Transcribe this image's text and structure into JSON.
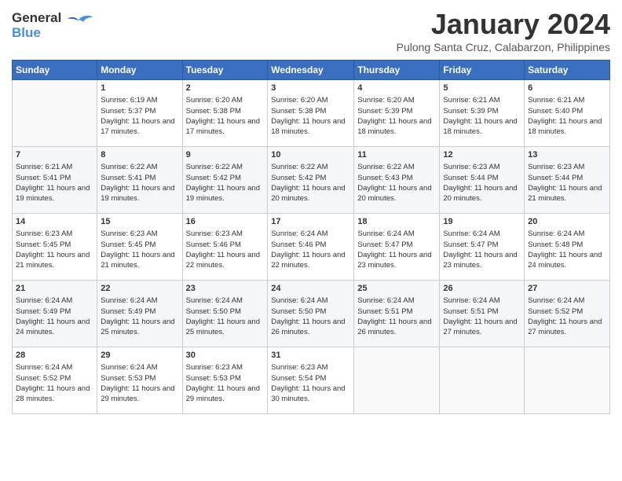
{
  "header": {
    "logo": {
      "line1": "General",
      "line2": "Blue"
    },
    "title": "January 2024",
    "location": "Pulong Santa Cruz, Calabarzon, Philippines"
  },
  "days_of_week": [
    "Sunday",
    "Monday",
    "Tuesday",
    "Wednesday",
    "Thursday",
    "Friday",
    "Saturday"
  ],
  "weeks": [
    [
      {
        "day": null
      },
      {
        "day": "1",
        "sunrise": "6:19 AM",
        "sunset": "5:37 PM",
        "daylight": "11 hours and 17 minutes."
      },
      {
        "day": "2",
        "sunrise": "6:20 AM",
        "sunset": "5:38 PM",
        "daylight": "11 hours and 17 minutes."
      },
      {
        "day": "3",
        "sunrise": "6:20 AM",
        "sunset": "5:38 PM",
        "daylight": "11 hours and 18 minutes."
      },
      {
        "day": "4",
        "sunrise": "6:20 AM",
        "sunset": "5:39 PM",
        "daylight": "11 hours and 18 minutes."
      },
      {
        "day": "5",
        "sunrise": "6:21 AM",
        "sunset": "5:39 PM",
        "daylight": "11 hours and 18 minutes."
      },
      {
        "day": "6",
        "sunrise": "6:21 AM",
        "sunset": "5:40 PM",
        "daylight": "11 hours and 18 minutes."
      }
    ],
    [
      {
        "day": "7",
        "sunrise": "6:21 AM",
        "sunset": "5:41 PM",
        "daylight": "11 hours and 19 minutes."
      },
      {
        "day": "8",
        "sunrise": "6:22 AM",
        "sunset": "5:41 PM",
        "daylight": "11 hours and 19 minutes."
      },
      {
        "day": "9",
        "sunrise": "6:22 AM",
        "sunset": "5:42 PM",
        "daylight": "11 hours and 19 minutes."
      },
      {
        "day": "10",
        "sunrise": "6:22 AM",
        "sunset": "5:42 PM",
        "daylight": "11 hours and 20 minutes."
      },
      {
        "day": "11",
        "sunrise": "6:22 AM",
        "sunset": "5:43 PM",
        "daylight": "11 hours and 20 minutes."
      },
      {
        "day": "12",
        "sunrise": "6:23 AM",
        "sunset": "5:44 PM",
        "daylight": "11 hours and 20 minutes."
      },
      {
        "day": "13",
        "sunrise": "6:23 AM",
        "sunset": "5:44 PM",
        "daylight": "11 hours and 21 minutes."
      }
    ],
    [
      {
        "day": "14",
        "sunrise": "6:23 AM",
        "sunset": "5:45 PM",
        "daylight": "11 hours and 21 minutes."
      },
      {
        "day": "15",
        "sunrise": "6:23 AM",
        "sunset": "5:45 PM",
        "daylight": "11 hours and 21 minutes."
      },
      {
        "day": "16",
        "sunrise": "6:23 AM",
        "sunset": "5:46 PM",
        "daylight": "11 hours and 22 minutes."
      },
      {
        "day": "17",
        "sunrise": "6:24 AM",
        "sunset": "5:46 PM",
        "daylight": "11 hours and 22 minutes."
      },
      {
        "day": "18",
        "sunrise": "6:24 AM",
        "sunset": "5:47 PM",
        "daylight": "11 hours and 23 minutes."
      },
      {
        "day": "19",
        "sunrise": "6:24 AM",
        "sunset": "5:47 PM",
        "daylight": "11 hours and 23 minutes."
      },
      {
        "day": "20",
        "sunrise": "6:24 AM",
        "sunset": "5:48 PM",
        "daylight": "11 hours and 24 minutes."
      }
    ],
    [
      {
        "day": "21",
        "sunrise": "6:24 AM",
        "sunset": "5:49 PM",
        "daylight": "11 hours and 24 minutes."
      },
      {
        "day": "22",
        "sunrise": "6:24 AM",
        "sunset": "5:49 PM",
        "daylight": "11 hours and 25 minutes."
      },
      {
        "day": "23",
        "sunrise": "6:24 AM",
        "sunset": "5:50 PM",
        "daylight": "11 hours and 25 minutes."
      },
      {
        "day": "24",
        "sunrise": "6:24 AM",
        "sunset": "5:50 PM",
        "daylight": "11 hours and 26 minutes."
      },
      {
        "day": "25",
        "sunrise": "6:24 AM",
        "sunset": "5:51 PM",
        "daylight": "11 hours and 26 minutes."
      },
      {
        "day": "26",
        "sunrise": "6:24 AM",
        "sunset": "5:51 PM",
        "daylight": "11 hours and 27 minutes."
      },
      {
        "day": "27",
        "sunrise": "6:24 AM",
        "sunset": "5:52 PM",
        "daylight": "11 hours and 27 minutes."
      }
    ],
    [
      {
        "day": "28",
        "sunrise": "6:24 AM",
        "sunset": "5:52 PM",
        "daylight": "11 hours and 28 minutes."
      },
      {
        "day": "29",
        "sunrise": "6:24 AM",
        "sunset": "5:53 PM",
        "daylight": "11 hours and 29 minutes."
      },
      {
        "day": "30",
        "sunrise": "6:23 AM",
        "sunset": "5:53 PM",
        "daylight": "11 hours and 29 minutes."
      },
      {
        "day": "31",
        "sunrise": "6:23 AM",
        "sunset": "5:54 PM",
        "daylight": "11 hours and 30 minutes."
      },
      {
        "day": null
      },
      {
        "day": null
      },
      {
        "day": null
      }
    ]
  ]
}
